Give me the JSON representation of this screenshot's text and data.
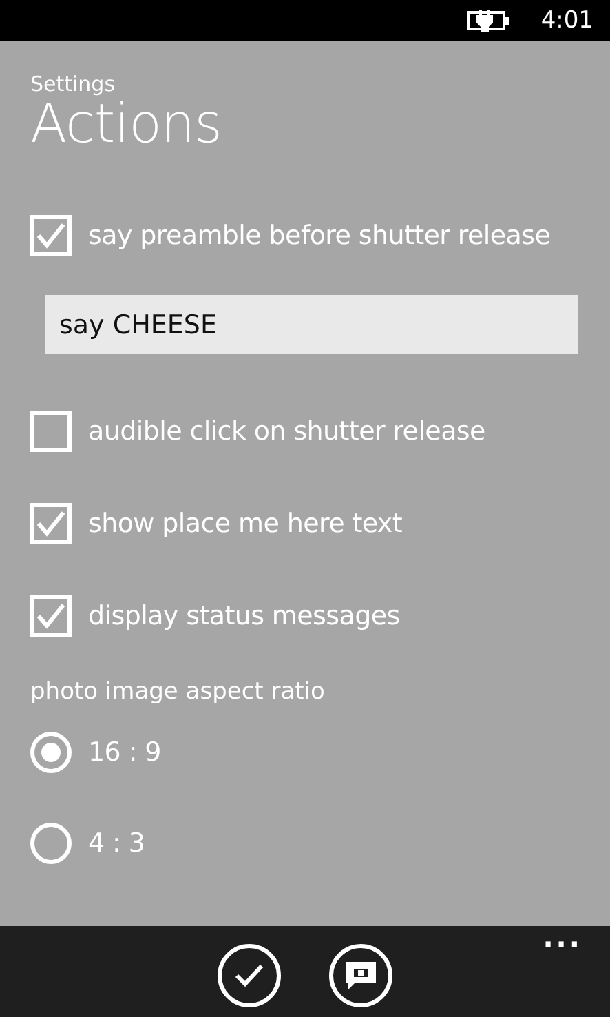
{
  "status_bar": {
    "time": "4:01"
  },
  "header": {
    "app": "Settings",
    "title": "Actions"
  },
  "options": [
    {
      "kind": "checkbox",
      "label": "say preamble before shutter release",
      "checked": true
    },
    {
      "kind": "textbox",
      "value": "say CHEESE"
    },
    {
      "kind": "checkbox",
      "label": "audible click on shutter release",
      "checked": false
    },
    {
      "kind": "checkbox",
      "label": "show place me here text",
      "checked": true
    },
    {
      "kind": "checkbox",
      "label": "display status messages",
      "checked": true
    }
  ],
  "aspect_ratio": {
    "label": "photo image aspect ratio",
    "choices": [
      {
        "label": "16 : 9",
        "selected": true
      },
      {
        "label": "4 : 3",
        "selected": false
      }
    ]
  },
  "app_bar": {
    "more": "..."
  }
}
